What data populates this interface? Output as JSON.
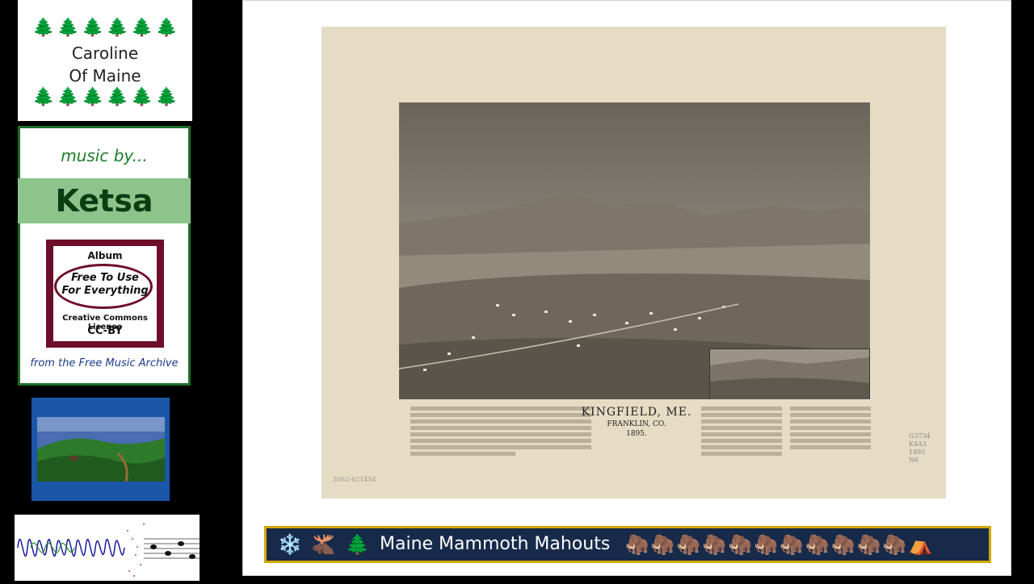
{
  "sidebar": {
    "title_line1": "Caroline",
    "title_line2": "Of Maine",
    "tree_glyph": "🌲",
    "music_by": "music by...",
    "artist": "Ketsa",
    "album_label": "Album",
    "album_line1": "Free To Use",
    "album_line2": "For Everything",
    "license_text": "Creative Commons License",
    "license_code": "CC-BY",
    "source": "from the Free Music Archive"
  },
  "slide": {
    "map_title": "KINGFIELD, ME.",
    "map_county": "FRANKLIN, CO.",
    "map_year": "1895.",
    "catalog_l1": "G3734",
    "catalog_l2": "K4A3",
    "catalog_l3": "1895",
    "catalog_l4": "N6",
    "stamp": "3062-621454"
  },
  "banner": {
    "snowflake_icon": "❄️",
    "moose_icon": "🫎",
    "tree_icon": "🌲",
    "title": "Maine Mammoth Mahouts",
    "mammoth_icon": "🦣",
    "tent_icon": "⛺"
  },
  "colors": {
    "tree_green": "#1a8a2a",
    "artist_band": "#8cc48c",
    "album_maroon": "#6d0e2a",
    "banner_bg": "#172a4a",
    "banner_border": "#d4a500"
  }
}
